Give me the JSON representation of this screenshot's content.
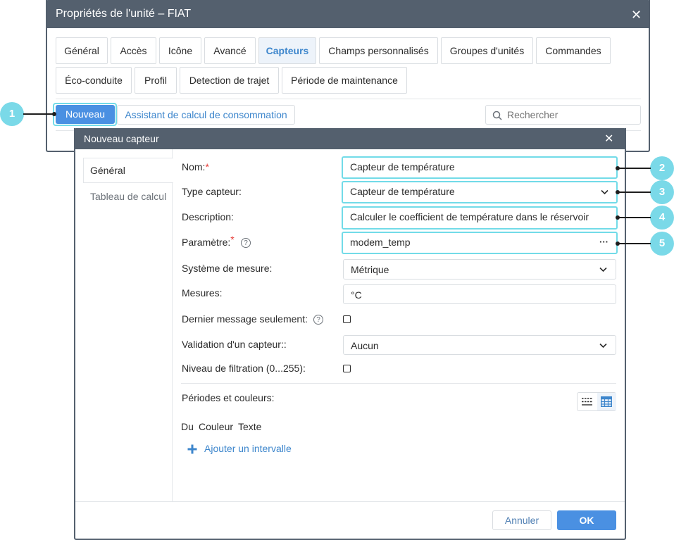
{
  "outer_dialog": {
    "title": "Propriétés de l'unité – FIAT",
    "close_icon": "close-icon",
    "tabs": [
      {
        "label": "Général"
      },
      {
        "label": "Accès"
      },
      {
        "label": "Icône"
      },
      {
        "label": "Avancé"
      },
      {
        "label": "Capteurs",
        "active": true
      },
      {
        "label": "Champs personnalisés"
      },
      {
        "label": "Groupes d'unités"
      },
      {
        "label": "Commandes"
      },
      {
        "label": "Éco-conduite"
      },
      {
        "label": "Profil"
      },
      {
        "label": "Detection de trajet"
      },
      {
        "label": "Période de maintenance"
      }
    ],
    "toolbar": {
      "new_label": "Nouveau",
      "wizard_label": "Assistant de calcul de consommation",
      "search_placeholder": "Rechercher"
    }
  },
  "inner_dialog": {
    "title": "Nouveau capteur",
    "side_tabs": [
      {
        "label": "Général",
        "active": true
      },
      {
        "label": "Tableau de calcul"
      }
    ],
    "form": {
      "name_label": "Nom:",
      "name_value": "Capteur de température",
      "type_label": "Type capteur:",
      "type_value": "Capteur de température",
      "description_label": "Description:",
      "description_value": "Calculer le coefficient de température dans le réservoir",
      "parameter_label": "Paramètre:",
      "parameter_value": "modem_temp",
      "parameter_more": "···",
      "measure_system_label": "Système de mesure:",
      "measure_system_value": "Métrique",
      "units_label": "Mesures:",
      "units_value": "°C",
      "last_message_label": "Dernier message seulement:",
      "validation_label": "Validation d'un capteur::",
      "validation_value": "Aucun",
      "filter_label": "Niveau de filtration (0...255):",
      "required_mark": "*",
      "help_mark": "?"
    },
    "intervals": {
      "section_label": "Périodes et couleurs:",
      "col_from": "Du",
      "col_color": "Couleur",
      "col_text": "Texte",
      "add_label": "Ajouter un intervalle"
    },
    "footer": {
      "cancel_label": "Annuler",
      "ok_label": "OK"
    }
  },
  "callouts": [
    "1",
    "2",
    "3",
    "4",
    "5"
  ],
  "colors": {
    "title_bar": "#54606e",
    "accent": "#4a90e2",
    "link": "#3d86cc",
    "callout": "#7ad9e8",
    "highlight_border": "#72dbe8",
    "required": "#e53935"
  }
}
